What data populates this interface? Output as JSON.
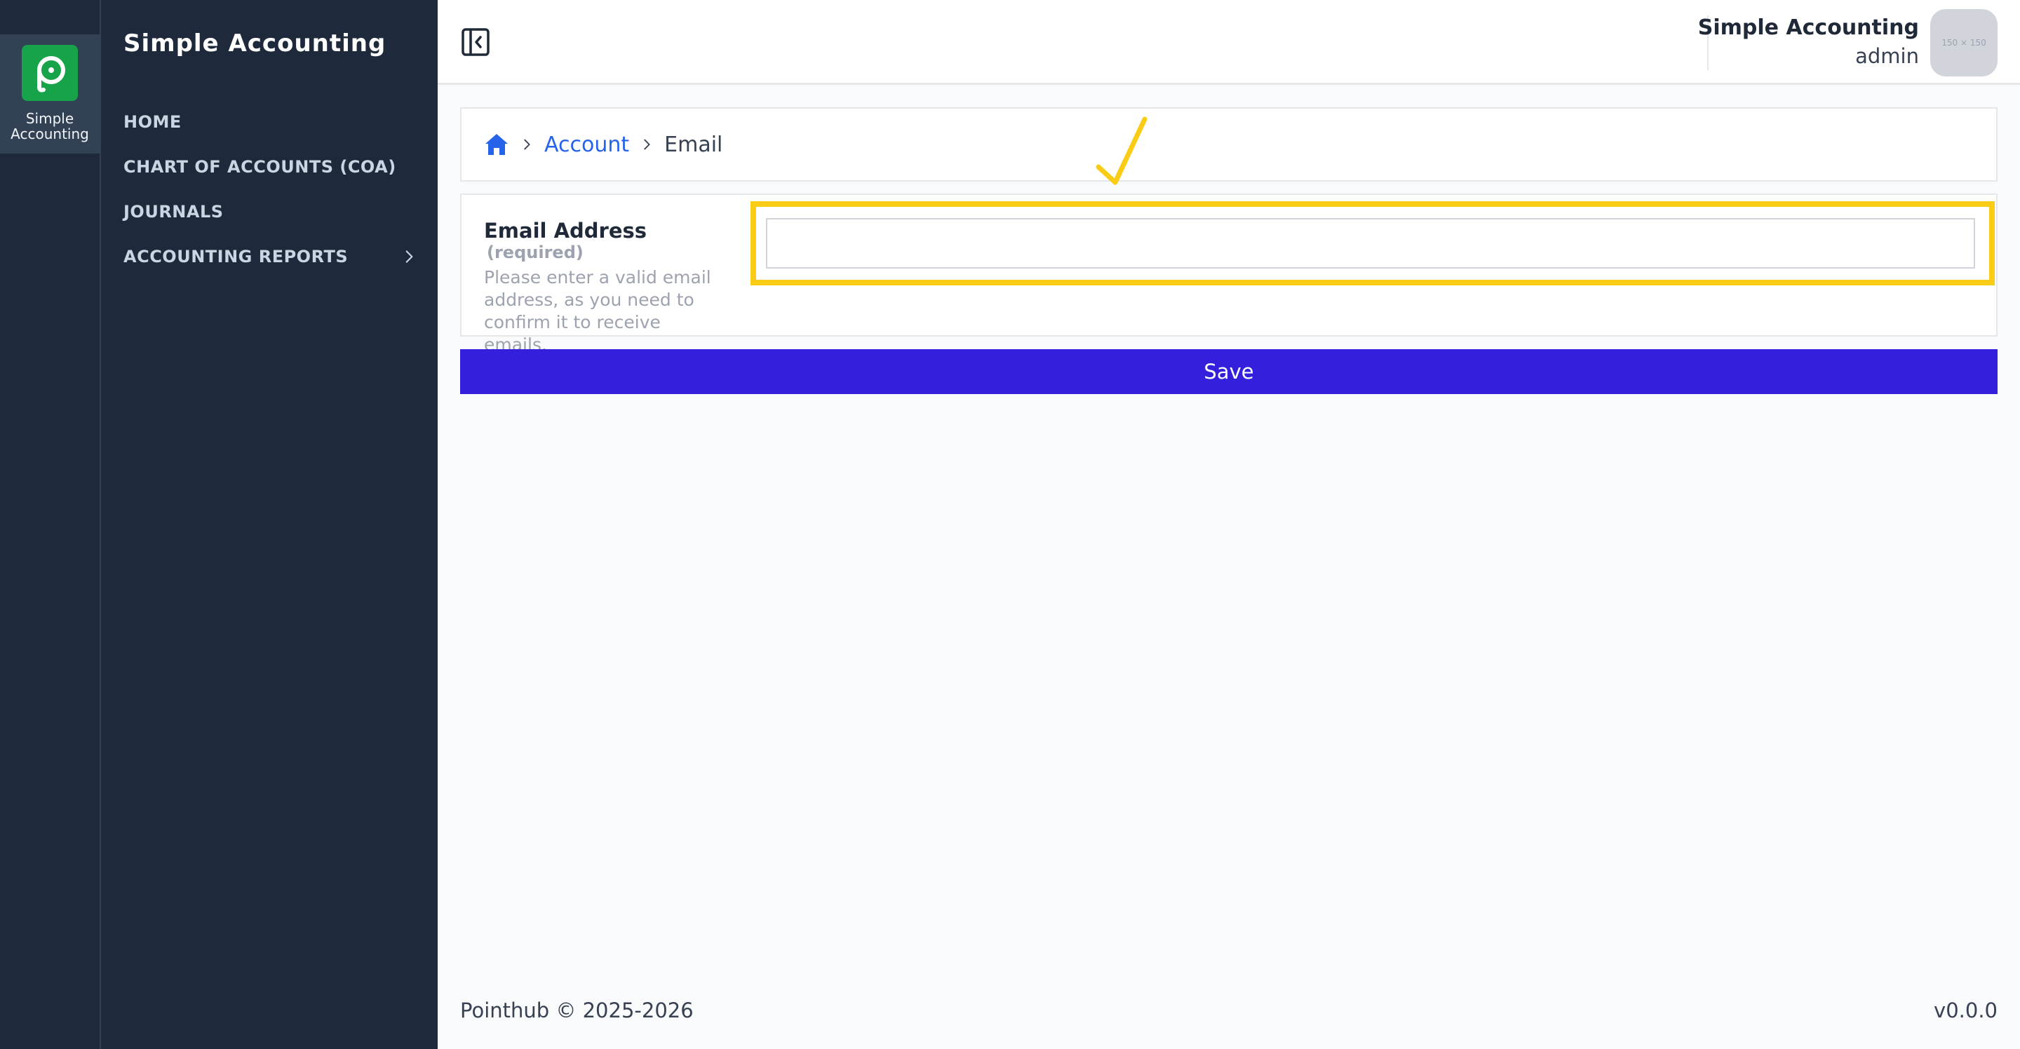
{
  "rail": {
    "app_label": "Simple\nAccounting"
  },
  "sidebar": {
    "title": "Simple Accounting",
    "items": [
      {
        "label": "HOME"
      },
      {
        "label": "CHART OF ACCOUNTS (COA)"
      },
      {
        "label": "JOURNALS"
      },
      {
        "label": "ACCOUNTING REPORTS"
      }
    ]
  },
  "header": {
    "app_name": "Simple Accounting",
    "user_role": "admin",
    "avatar_text": "150 × 150"
  },
  "breadcrumb": {
    "items": [
      {
        "label": "Account"
      },
      {
        "label": "Email"
      }
    ]
  },
  "form": {
    "email_label": "Email Address",
    "required_text": "(required)",
    "help_text": "Please enter a valid email address, as you need to confirm it to receive emails.",
    "email_value": "",
    "save_label": "Save"
  },
  "footer": {
    "copyright": "Pointhub © 2025-2026",
    "version": "v0.0.0"
  },
  "colors": {
    "sidebar_bg": "#1e293b",
    "logo_green": "#16a34a",
    "link_blue": "#2563eb",
    "save_button": "#3420dc",
    "highlight_yellow": "#facc15"
  },
  "icons": [
    "app-logo-icon",
    "collapse-sidebar-icon",
    "home-icon",
    "chevron-right-icon",
    "annotation-arrow-icon"
  ]
}
